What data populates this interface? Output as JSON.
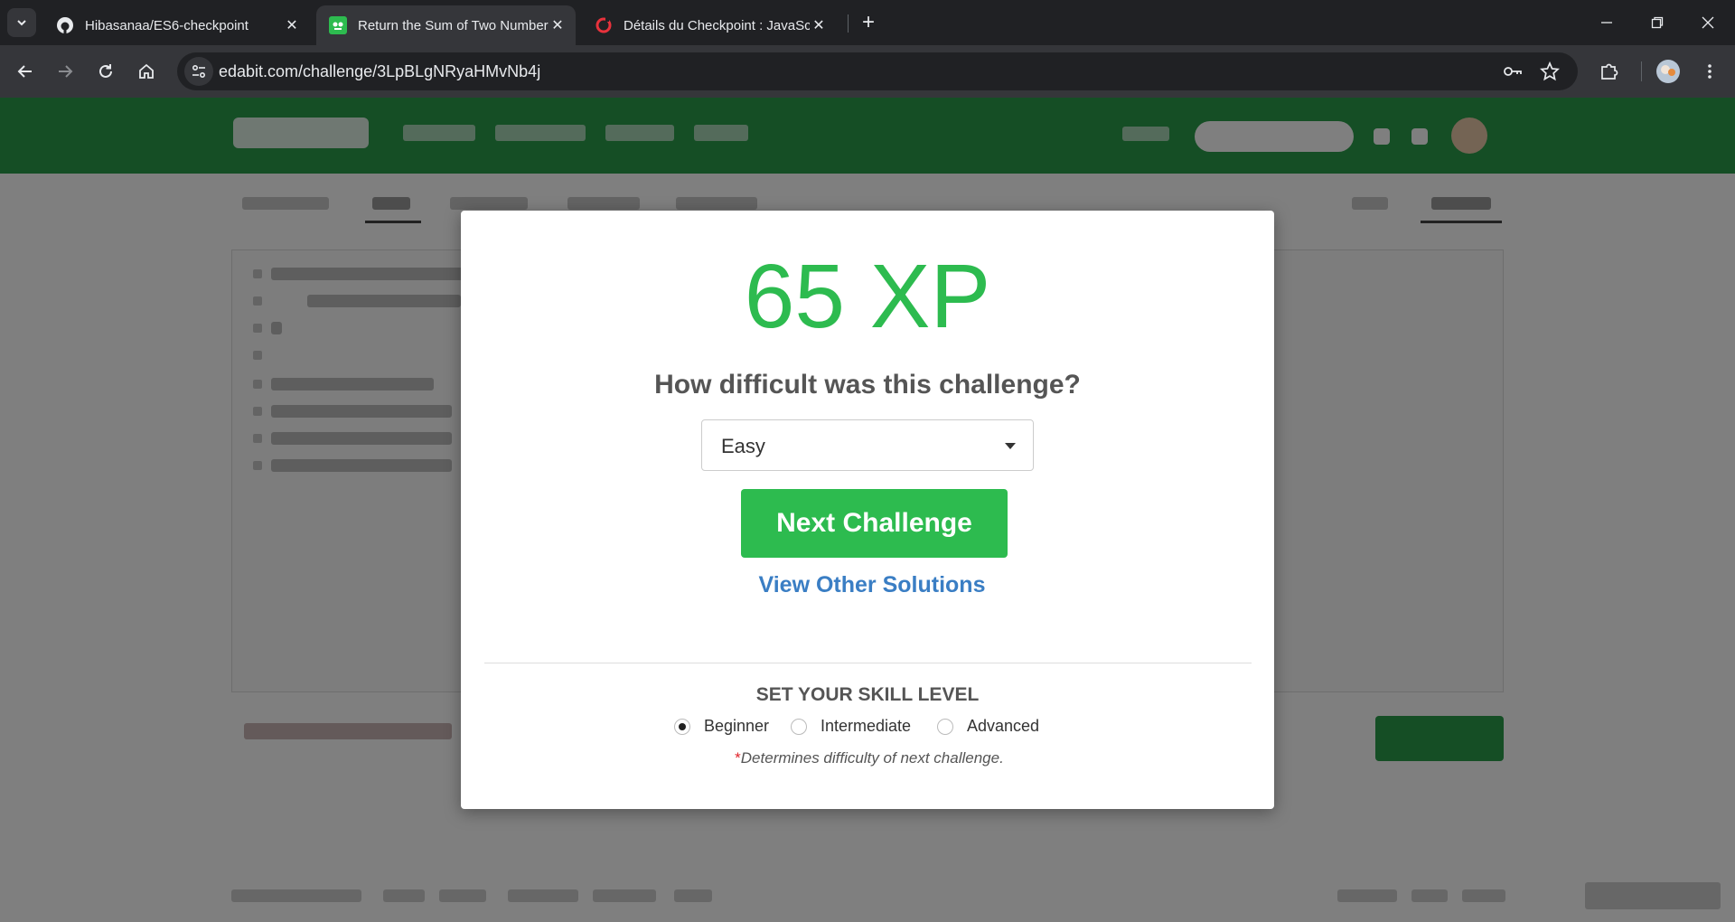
{
  "browser": {
    "tabs": [
      {
        "title": "Hibasanaa/ES6-checkpoint",
        "favicon": "github-icon",
        "active": false
      },
      {
        "title": "Return the Sum of Two Numbers",
        "favicon": "edabit-icon",
        "active": true
      },
      {
        "title": "Détails du Checkpoint : JavaScript",
        "favicon": "gomycode-icon",
        "active": false
      }
    ],
    "url": "edabit.com/challenge/3LpBLgNRyaHMvNb4j",
    "colors": {
      "tabbar": "#202124",
      "toolbar": "#35363a"
    }
  },
  "modal": {
    "xp": "65 XP",
    "question": "How difficult was this challenge?",
    "difficulty_selected": "Easy",
    "next_button": "Next Challenge",
    "view_solutions": "View Other Solutions",
    "skill_title": "SET YOUR SKILL LEVEL",
    "skill_options": [
      {
        "label": "Beginner",
        "checked": true
      },
      {
        "label": "Intermediate",
        "checked": false
      },
      {
        "label": "Advanced",
        "checked": false
      }
    ],
    "note_mark": "*",
    "note": "Determines difficulty of next challenge.",
    "colors": {
      "accent_green": "#2dbb4f",
      "link_blue": "#3a7ec4",
      "required_red": "#e0242b"
    }
  }
}
